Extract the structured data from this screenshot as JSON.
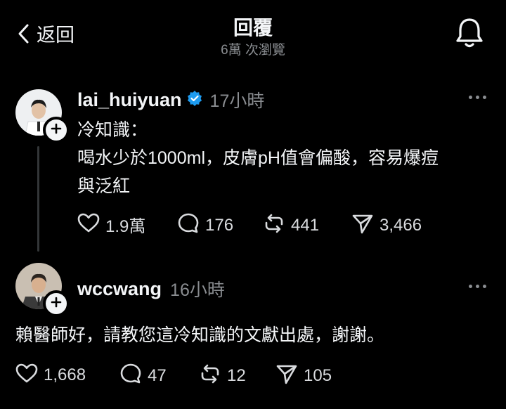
{
  "header": {
    "back_label": "返回",
    "title": "回覆",
    "subtitle": "6萬 次瀏覽"
  },
  "post": {
    "username": "lai_huiyuan",
    "verified": true,
    "time": "17小時",
    "lines": [
      "冷知識：",
      "喝水少於1000ml，皮膚pH值會偏酸，容易爆痘",
      "與泛紅"
    ],
    "likes": "1.9萬",
    "comments": "176",
    "reposts": "441",
    "shares": "3,466"
  },
  "reply": {
    "username": "wccwang",
    "time": "16小時",
    "text": "賴醫師好，請教您這冷知識的文獻出處，謝謝。",
    "likes": "1,668",
    "comments": "47",
    "reposts": "12",
    "shares": "105"
  },
  "icons": {
    "back": "chevron-left-icon",
    "bell": "bell-icon",
    "like": "heart-icon",
    "comment": "comment-icon",
    "repost": "repost-icon",
    "share": "send-icon",
    "more": "more-dots-icon",
    "verified": "verified-badge-icon",
    "follow": "plus-icon"
  },
  "colors": {
    "background": "#000000",
    "text": "#f3f5f7",
    "muted": "#8a8d91",
    "verified": "#1d9bf0"
  }
}
